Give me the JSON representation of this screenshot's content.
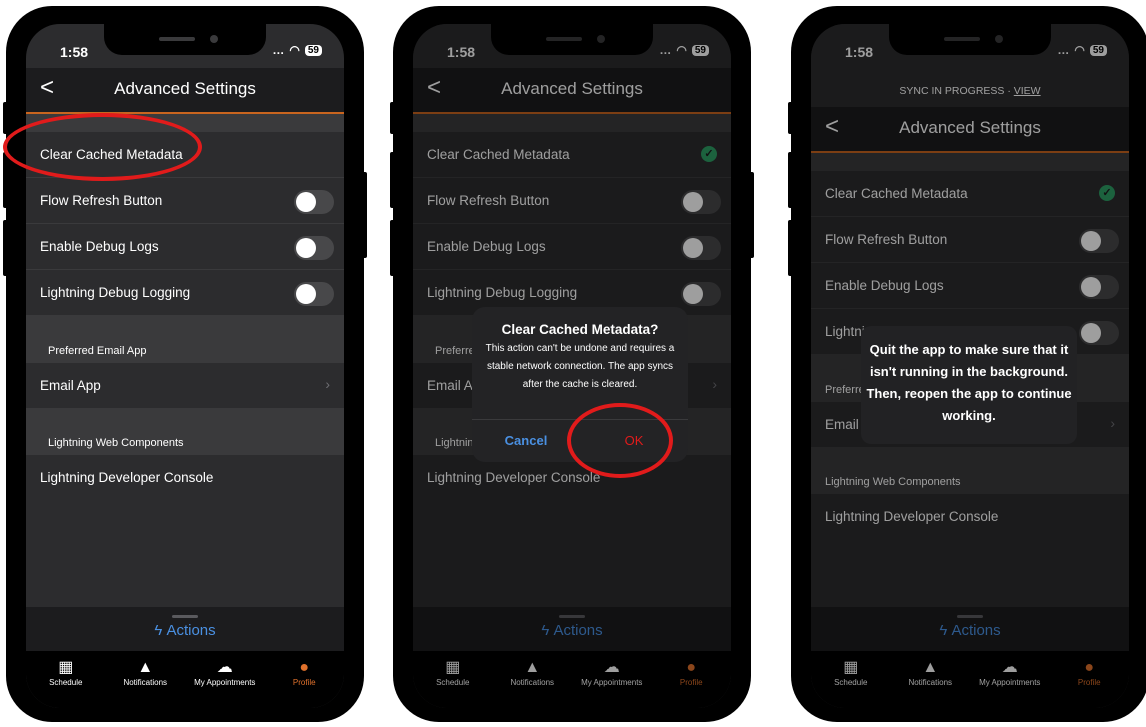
{
  "status": {
    "time": "1:58",
    "battery": "59"
  },
  "nav": {
    "title": "Advanced Settings",
    "back": "<"
  },
  "rows": {
    "clear_cache": "Clear Cached Metadata",
    "flow_refresh": "Flow Refresh Button",
    "debug_logs": "Enable Debug Logs",
    "lightning_debug": "Lightning Debug Logging",
    "email_app": "Email App",
    "dev_console": "Lightning Developer Console"
  },
  "sections": {
    "email": "Preferred Email App",
    "lwc": "Lightning Web Components"
  },
  "actions": "Actions",
  "tabs": [
    "Schedule",
    "Notifications",
    "My Appointments",
    "Profile"
  ],
  "alert": {
    "title": "Clear Cached Metadata?",
    "message": "This action can't be undone and requires a stable network connection. The app syncs after the cache is cleared.",
    "cancel": "Cancel",
    "ok": "OK"
  },
  "sync_banner": {
    "text": "SYNC IN PROGRESS · ",
    "link": "VIEW"
  },
  "toast": "Quit the app to make sure that it isn't running in the background. Then, reopen the app to continue working.",
  "colors": {
    "accent": "#c9651f",
    "link_blue": "#4a90e2",
    "check_green": "#2e9e64",
    "annotation_red": "#e11b1b"
  }
}
